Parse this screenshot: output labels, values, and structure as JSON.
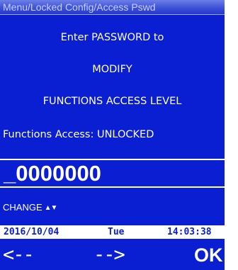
{
  "breadcrumb": "Menu/Locked Config/Access Pswd",
  "message": {
    "line1": "Enter PASSWORD to",
    "line2": "MODIFY",
    "line3": "FUNCTIONS ACCESS LEVEL"
  },
  "status": "Functions Access: UNLOCKED",
  "password_field": {
    "value": "_0000000"
  },
  "change": {
    "label": "CHANGE",
    "arrows": "▲▼"
  },
  "datebar": {
    "date": "2016/10/04",
    "day": "Tue",
    "time": "14:03:38"
  },
  "softkeys": {
    "left": "<--",
    "right": "-->",
    "ok": "OK"
  },
  "colors": {
    "screen": "#0a1ed2",
    "text": "#ffffff",
    "datebar": "#ffffff"
  }
}
